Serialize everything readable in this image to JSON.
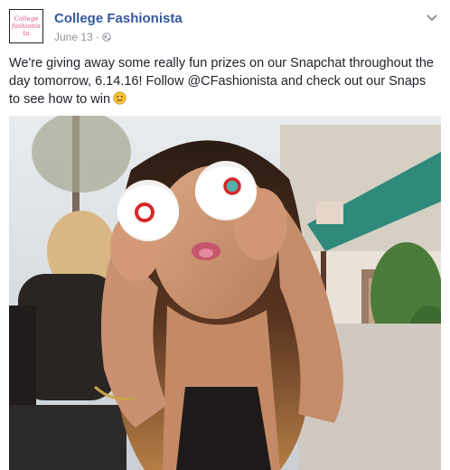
{
  "page": {
    "name": "College Fashionista",
    "avatar_text": "College fashionista",
    "accent_color": "#365899"
  },
  "post": {
    "date": "June 13",
    "separator": "·",
    "privacy_icon": "globe-icon",
    "menu_icon": "chevron-down-icon",
    "text": "We're giving away some really fun prizes on our Snapchat throughout the day tomorrow, 6.14.16! Follow @CFashionista and check out our Snaps to see how to win",
    "emoji": "slightly-smiling-face-icon"
  },
  "photo": {
    "subject": "woman holding two frosted cupcakes over her eyes on a city street"
  }
}
